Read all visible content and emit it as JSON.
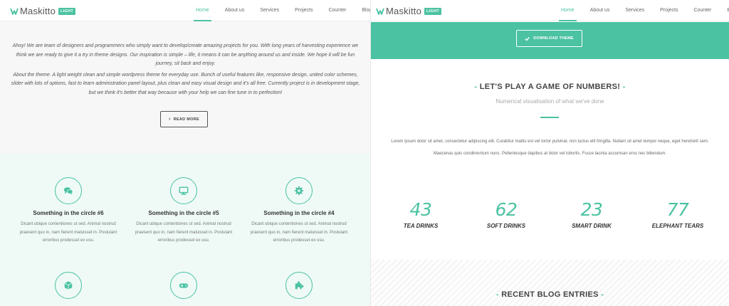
{
  "left": {
    "logo": {
      "name": "Maskitto",
      "badge": "LIGHT"
    },
    "menu": [
      "Home",
      "About us",
      "Services",
      "Projects",
      "Counter",
      "Blog"
    ],
    "active_menu": "Home",
    "intro": {
      "p1": "Ahoy! We are team of designers and programmers who simply want to develop/create amazing projects for you. With long years of harvesting experience we think we are ready to give it a try in theme designs. Our inspiration is simple – life, it means it can be anything around us and inside. We hope it will be fun journey, sit back and enjoy.",
      "p2": "About the theme. A light weight clean and simple wordpress theme for everyday use. Bunch of useful features like, responsive design, united color schemes, slider with lots of options, fast to learn administration panel layout, plus clean and easy visual design and it's all free. Currently project is in development stage, but we think it's better that way because with your help we can fine tune in to perfection!",
      "button": "READ MORE",
      "button_icon": "chevron-right-icon"
    },
    "circles": [
      {
        "icon": "chat-bubbles-icon",
        "title": "Something in the circle #6",
        "desc": "Dicant ubique contentiones ut sed. Animal nostrud praesent quo in, nam fierent maluisset in. Postulant erroribus prodesset ex usu."
      },
      {
        "icon": "monitor-icon",
        "title": "Something in the circle #5",
        "desc": "Dicant ubique contentiones ut sed. Animal nostrud praesent quo in, nam fierent maluisset in. Postulant erroribus prodesset ex usu."
      },
      {
        "icon": "gear-icon",
        "title": "Something in the circle #4",
        "desc": "Dicant ubique contentiones ut sed. Animal nostrud praesent quo in, nam fierent maluisset in. Postulant erroribus prodesset ex usu."
      },
      {
        "icon": "cube-icon"
      },
      {
        "icon": "gamepad-icon"
      },
      {
        "icon": "puzzle-icon"
      }
    ]
  },
  "right": {
    "logo": {
      "name": "Maskitto",
      "badge": "LIGHT"
    },
    "menu": [
      "Home",
      "About us",
      "Services",
      "Projects",
      "Counter",
      "Blog"
    ],
    "active_menu": "Home",
    "download_button": "DOWNLOAD THEME",
    "download_icon": "checkmark-icon",
    "numbers": {
      "title": "LET'S PLAY A GAME OF NUMBERS!",
      "subtitle": "Numerical visualisation of what we've done",
      "body": "Lorem ipsum dolor sit amet, consectetur adipiscing elit. Curabitur mattis est vel tortor pulvinar, non luctus elit fringilla. Nullam sit amet tempor neque, eget hendrerit sem. Maecenas quis condimentum nunc. Pellentesque dapibus at dolor vel lobortis. Fusce lacinia accumsan eros nec bibendum.",
      "stats": [
        {
          "value": "43",
          "label": "TEA DRINKS"
        },
        {
          "value": "62",
          "label": "SOFT DRINKS"
        },
        {
          "value": "23",
          "label": "SMART DRINK"
        },
        {
          "value": "77",
          "label": "ELEPHANT TEARS"
        }
      ]
    },
    "blog_title": "RECENT BLOG ENTRIES"
  },
  "colors": {
    "accent": "#4bc2a2",
    "text": "#555555",
    "light_band": "#effaf7"
  }
}
